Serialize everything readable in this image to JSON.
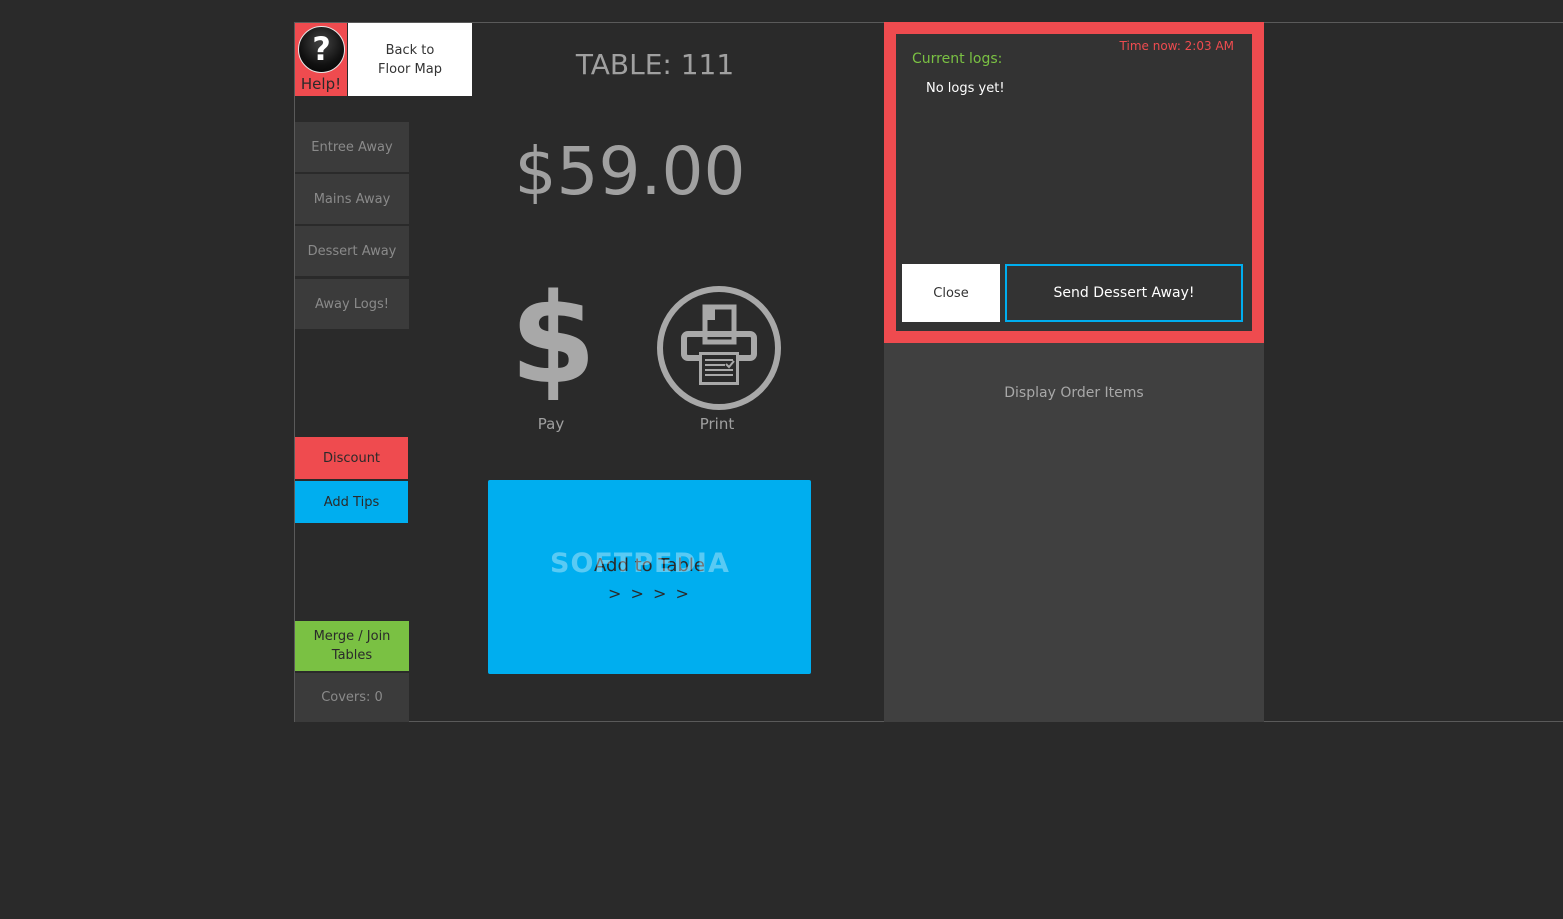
{
  "header": {
    "help_icon_glyph": "?",
    "help_label": "Help!",
    "back_label_line1": "Back to",
    "back_label_line2": "Floor Map"
  },
  "sidebar": {
    "items": [
      {
        "label": "Entree Away"
      },
      {
        "label": "Mains Away"
      },
      {
        "label": "Dessert Away"
      },
      {
        "label": "Away Logs!"
      }
    ],
    "discount_label": "Discount",
    "tips_label": "Add Tips",
    "merge_line1": "Merge / Join",
    "merge_line2": "Tables",
    "covers_label": "Covers: 0"
  },
  "main": {
    "table_title": "TABLE: 111",
    "amount": "$59.00",
    "pay_glyph": "$",
    "pay_label": "Pay",
    "print_label": "Print",
    "add_label": "Add to Table",
    "add_arrows": "> > > >",
    "watermark": "SOFTPEDIA"
  },
  "logs": {
    "time_now": "Time now: 2:03 AM",
    "title": "Current logs:",
    "empty_text": "No logs yet!",
    "close_label": "Close",
    "send_label": "Send Dessert Away!"
  },
  "order": {
    "label": "Display Order Items"
  },
  "colors": {
    "background": "#2a2a2a",
    "red": "#ef4b4f",
    "blue": "#00aeef",
    "green": "#7ac143",
    "gray_button": "#3b3b3b",
    "panel": "#404040"
  }
}
